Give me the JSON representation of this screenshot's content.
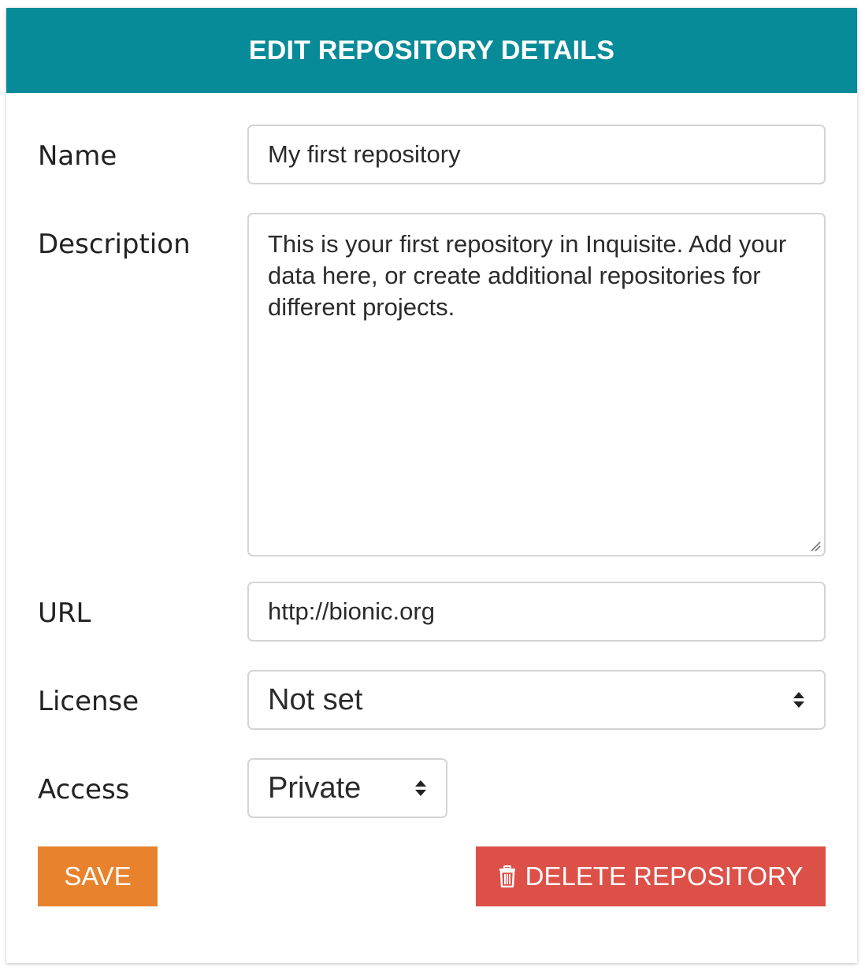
{
  "header": {
    "title": "EDIT REPOSITORY DETAILS"
  },
  "form": {
    "name": {
      "label": "Name",
      "value": "My first repository"
    },
    "description": {
      "label": "Description",
      "value": "This is your first repository in Inquisite. Add your data here, or create additional repositories for different projects."
    },
    "url": {
      "label": "URL",
      "value": "http://bionic.org"
    },
    "license": {
      "label": "License",
      "selected": "Not set"
    },
    "access": {
      "label": "Access",
      "selected": "Private"
    }
  },
  "actions": {
    "save_label": "SAVE",
    "delete_label": "DELETE REPOSITORY",
    "delete_icon": "trash-icon"
  },
  "colors": {
    "header_bg": "#088b98",
    "save_bg": "#e8822c",
    "delete_bg": "#dc5048"
  }
}
